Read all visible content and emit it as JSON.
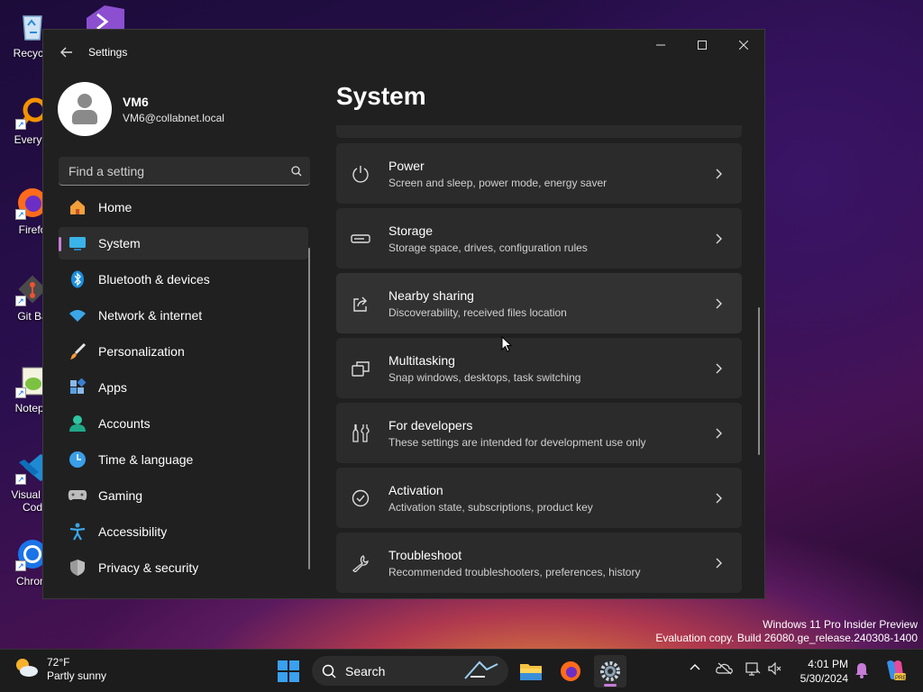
{
  "desktop": {
    "icons": [
      {
        "label": "Recycle",
        "icon": "recycle-bin-icon"
      },
      {
        "label": "Everyth",
        "icon": "everything-search-icon"
      },
      {
        "label": "Firefo",
        "icon": "firefox-icon"
      },
      {
        "label": "Git Ba",
        "icon": "git-bash-icon"
      },
      {
        "label": "Notepa",
        "icon": "notepad-plus-plus-icon"
      },
      {
        "label": "Visual St",
        "label2": "Cod",
        "icon": "vscode-icon"
      },
      {
        "label": "Chrom",
        "icon": "chrome-icon"
      }
    ],
    "watermark_line1": "Windows 11 Pro Insider Preview",
    "watermark_line2": "Evaluation copy. Build 26080.ge_release.240308-1400"
  },
  "window": {
    "title": "Settings",
    "controls": {
      "minimize": "–",
      "maximize": "☐",
      "close": "✕"
    }
  },
  "profile": {
    "name": "VM6",
    "email": "VM6@collabnet.local"
  },
  "search": {
    "placeholder": "Find a setting"
  },
  "nav": [
    {
      "label": "Home",
      "icon": "home-icon",
      "active": false
    },
    {
      "label": "System",
      "icon": "system-icon",
      "active": true
    },
    {
      "label": "Bluetooth & devices",
      "icon": "bluetooth-icon",
      "active": false
    },
    {
      "label": "Network & internet",
      "icon": "wifi-icon",
      "active": false
    },
    {
      "label": "Personalization",
      "icon": "brush-icon",
      "active": false
    },
    {
      "label": "Apps",
      "icon": "apps-icon",
      "active": false
    },
    {
      "label": "Accounts",
      "icon": "accounts-icon",
      "active": false
    },
    {
      "label": "Time & language",
      "icon": "time-language-icon",
      "active": false
    },
    {
      "label": "Gaming",
      "icon": "gaming-icon",
      "active": false
    },
    {
      "label": "Accessibility",
      "icon": "accessibility-icon",
      "active": false
    },
    {
      "label": "Privacy & security",
      "icon": "shield-icon",
      "active": false
    }
  ],
  "main": {
    "title": "System",
    "cards": [
      {
        "title": "Power",
        "subtitle": "Screen and sleep, power mode, energy saver",
        "icon": "power-icon"
      },
      {
        "title": "Storage",
        "subtitle": "Storage space, drives, configuration rules",
        "icon": "storage-icon"
      },
      {
        "title": "Nearby sharing",
        "subtitle": "Discoverability, received files location",
        "icon": "share-icon"
      },
      {
        "title": "Multitasking",
        "subtitle": "Snap windows, desktops, task switching",
        "icon": "multitasking-icon"
      },
      {
        "title": "For developers",
        "subtitle": "These settings are intended for development use only",
        "icon": "developer-tools-icon"
      },
      {
        "title": "Activation",
        "subtitle": "Activation state, subscriptions, product key",
        "icon": "checkmark-circle-icon"
      },
      {
        "title": "Troubleshoot",
        "subtitle": "Recommended troubleshooters, preferences, history",
        "icon": "wrench-icon"
      }
    ]
  },
  "taskbar": {
    "weather_temp": "72°F",
    "weather_desc": "Partly sunny",
    "search_label": "Search",
    "time": "4:01 PM",
    "date": "5/30/2024"
  },
  "colors": {
    "accent": "#c77dd8",
    "window_bg": "#202020",
    "card_bg": "#2b2b2b"
  }
}
